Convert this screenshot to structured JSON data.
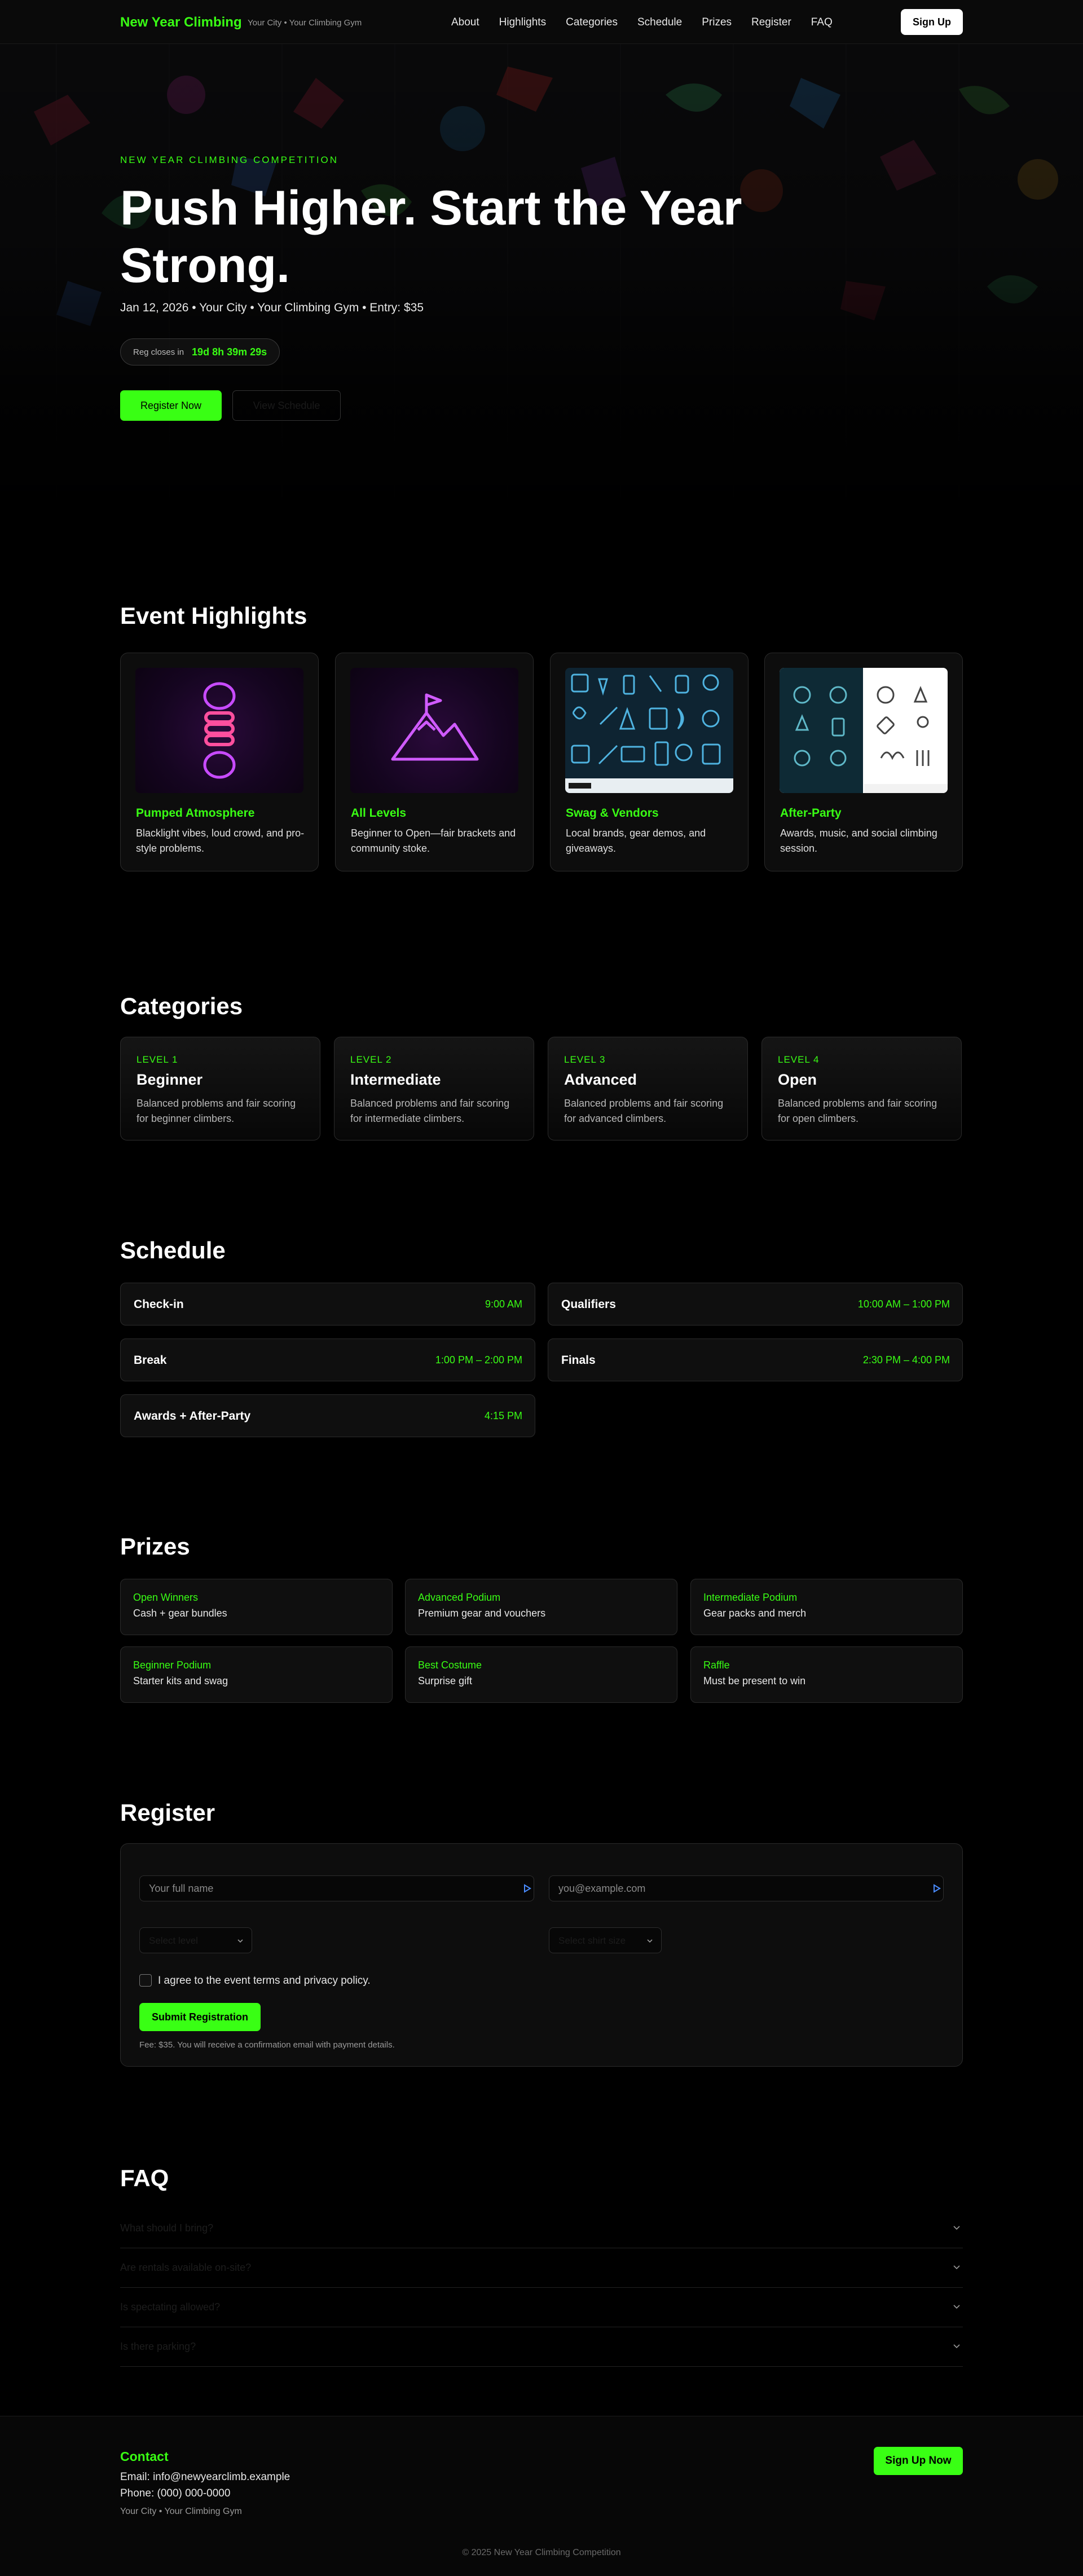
{
  "nav": {
    "brand": "New Year Climbing",
    "brand_sub": "Your City • Your Climbing Gym",
    "links": [
      "About",
      "Highlights",
      "Categories",
      "Schedule",
      "Prizes",
      "Register",
      "FAQ"
    ],
    "signup": "Sign Up"
  },
  "hero": {
    "kicker": "NEW YEAR CLIMBING COMPETITION",
    "title": "Push Higher. Start the Year Strong.",
    "meta": "Jan 12, 2026 • Your City • Your Climbing Gym • Entry: $35",
    "countdown_label": "Reg closes in",
    "countdown_value": "19d 8h 39m 29s",
    "primary_button": "Register Now",
    "secondary_button": "View Schedule"
  },
  "highlights": {
    "heading": "Event Highlights",
    "cards": [
      {
        "title": "Pumped Atmosphere",
        "desc": "Blacklight vibes, loud crowd, and pro-style problems.",
        "icon": "rope-icon"
      },
      {
        "title": "All Levels",
        "desc": "Beginner to Open—fair brackets and community stoke.",
        "icon": "mountain-icon"
      },
      {
        "title": "Swag & Vendors",
        "desc": "Local brands, gear demos, and giveaways.",
        "icon": "gear-collage-icon"
      },
      {
        "title": "After-Party",
        "desc": "Awards, music, and social climbing session.",
        "icon": "icon-sheet"
      }
    ]
  },
  "categories": {
    "heading": "Categories",
    "items": [
      {
        "level": "LEVEL 1",
        "name": "Beginner",
        "desc": "Balanced problems and fair scoring for beginner climbers."
      },
      {
        "level": "LEVEL 2",
        "name": "Intermediate",
        "desc": "Balanced problems and fair scoring for intermediate climbers."
      },
      {
        "level": "LEVEL 3",
        "name": "Advanced",
        "desc": "Balanced problems and fair scoring for advanced climbers."
      },
      {
        "level": "LEVEL 4",
        "name": "Open",
        "desc": "Balanced problems and fair scoring for open climbers."
      }
    ]
  },
  "schedule": {
    "heading": "Schedule",
    "items": [
      {
        "name": "Check-in",
        "time": "9:00 AM"
      },
      {
        "name": "Qualifiers",
        "time": "10:00 AM – 1:00 PM"
      },
      {
        "name": "Break",
        "time": "1:00 PM – 2:00 PM"
      },
      {
        "name": "Finals",
        "time": "2:30 PM – 4:00 PM"
      },
      {
        "name": "Awards + After-Party",
        "time": "4:15 PM"
      }
    ]
  },
  "prizes": {
    "heading": "Prizes",
    "items": [
      {
        "title": "Open Winners",
        "desc": "Cash + gear bundles"
      },
      {
        "title": "Advanced Podium",
        "desc": "Premium gear and vouchers"
      },
      {
        "title": "Intermediate Podium",
        "desc": "Gear packs and merch"
      },
      {
        "title": "Beginner Podium",
        "desc": "Starter kits and swag"
      },
      {
        "title": "Best Costume",
        "desc": "Surprise gift"
      },
      {
        "title": "Raffle",
        "desc": "Must be present to win"
      }
    ]
  },
  "register": {
    "heading": "Register",
    "name_placeholder": "Your full name",
    "email_placeholder": "you@example.com",
    "category_select": "Select level",
    "shirt_select": "Select shirt size",
    "agree_label": "I agree to the event terms and privacy policy.",
    "submit": "Submit Registration",
    "note": "Fee: $35. You will receive a confirmation email with payment details."
  },
  "faq": {
    "heading": "FAQ",
    "questions": [
      "What should I bring?",
      "Are rentals available on-site?",
      "Is spectating allowed?",
      "Is there parking?"
    ]
  },
  "footer": {
    "title": "Contact",
    "email": "Email: info@newyearclimb.example",
    "phone": "Phone: (000) 000-0000",
    "address": "Your City • Your Climbing Gym",
    "button": "Sign Up Now",
    "copyright": "© 2025 New Year Climbing Competition"
  },
  "colors": {
    "accent": "#39ff14",
    "background": "#000000",
    "card": "#0d0d0d",
    "border": "#2b2b2b"
  }
}
